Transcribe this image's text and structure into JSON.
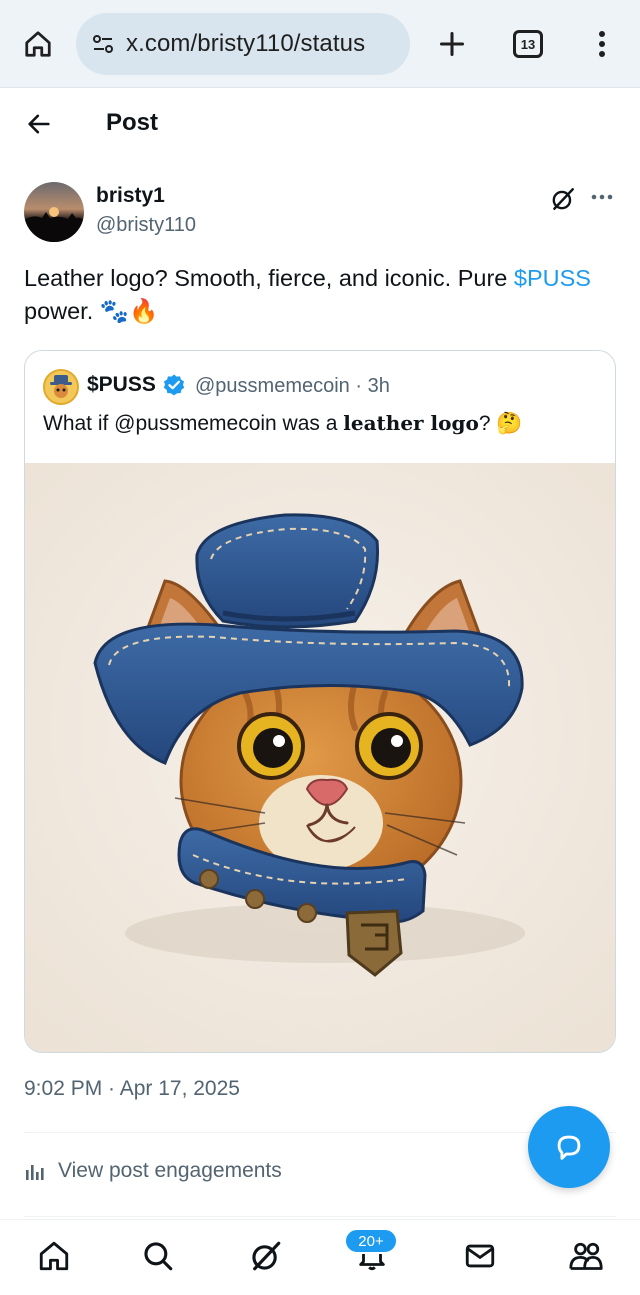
{
  "browser": {
    "url": "x.com/bristy110/status",
    "tab_count": "13"
  },
  "header": {
    "title": "Post"
  },
  "post": {
    "author_name": "bristy1",
    "author_handle": "@bristy110",
    "text_before": "Leather logo? Smooth, fierce, and iconic. Pure ",
    "cashtag": "$PUSS",
    "text_after": " power. 🐾🔥",
    "timestamp": "9:02 PM · Apr 17, 2025",
    "engagements_label": "View post engagements"
  },
  "quote": {
    "name": "$PUSS",
    "handle_time": "@pussmemecoin · 3h",
    "text_before": "What if @pussmemecoin was a ",
    "text_bold": "leather logo",
    "text_after": "? 🤔"
  },
  "bottom_nav": {
    "notifications_badge": "20+"
  },
  "colors": {
    "accent": "#1d9bf0",
    "secondary_text": "#536471",
    "primary_text": "#0f1419"
  }
}
